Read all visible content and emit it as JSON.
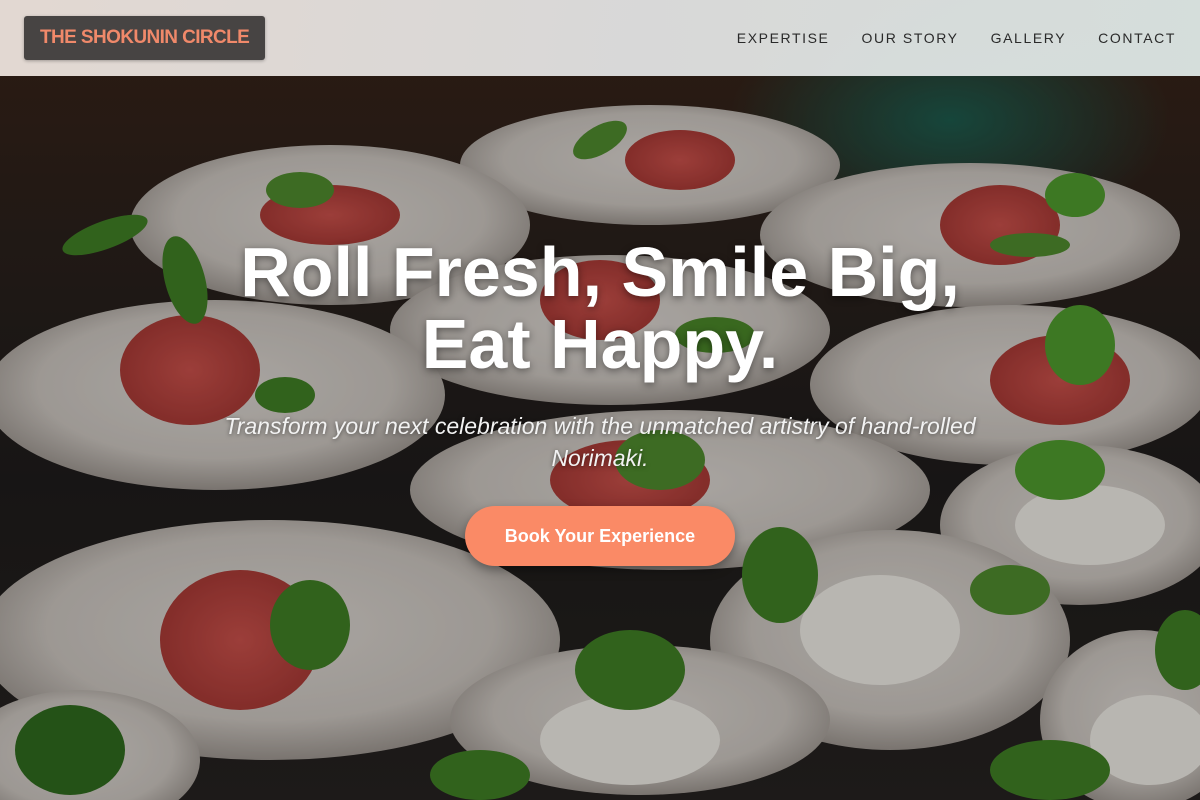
{
  "header": {
    "logo_text": "THE SHOKUNIN CIRCLE",
    "nav": [
      {
        "label": "EXPERTISE"
      },
      {
        "label": "OUR STORY"
      },
      {
        "label": "GALLERY"
      },
      {
        "label": "CONTACT"
      }
    ]
  },
  "hero": {
    "title_line1": "Roll Fresh, Smile Big,",
    "title_line2": "Eat Happy.",
    "subtitle": "Transform your next celebration with the unmatched artistry of hand-rolled Norimaki.",
    "cta_label": "Book Your Experience",
    "background_image": "plated-appetizers-photo"
  },
  "colors": {
    "accent": "#fa8a66",
    "logo_text": "#f0896a",
    "logo_bg": "#474443",
    "header_bg": "#e2e2e2"
  }
}
